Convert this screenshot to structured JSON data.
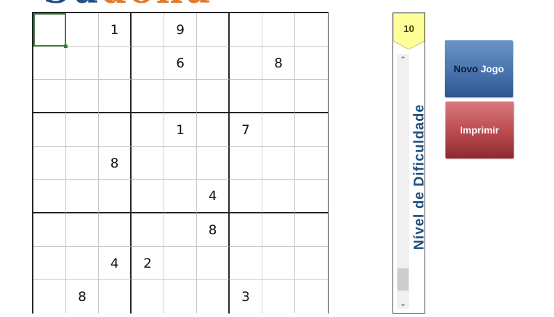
{
  "title": {
    "part_a": "Su",
    "part_b": "doku"
  },
  "grid": [
    [
      "",
      "",
      "1",
      "",
      "9",
      "",
      "",
      "",
      ""
    ],
    [
      "",
      "",
      "",
      "",
      "6",
      "",
      "",
      "8",
      ""
    ],
    [
      "",
      "",
      "",
      "",
      "",
      "",
      "",
      "",
      ""
    ],
    [
      "",
      "",
      "",
      "",
      "1",
      "",
      "7",
      "",
      ""
    ],
    [
      "",
      "",
      "8",
      "",
      "",
      "",
      "",
      "",
      ""
    ],
    [
      "",
      "",
      "",
      "",
      "",
      "4",
      "",
      "",
      ""
    ],
    [
      "",
      "",
      "",
      "",
      "",
      "8",
      "",
      "",
      ""
    ],
    [
      "",
      "",
      "4",
      "2",
      "",
      "",
      "",
      "",
      ""
    ],
    [
      "",
      "8",
      "",
      "",
      "",
      "",
      "3",
      "",
      ""
    ]
  ],
  "selected_cell": [
    0,
    0
  ],
  "difficulty": {
    "level": "10",
    "label": "Nível de Dificuldade",
    "badge_color": "#ffff99",
    "label_color": "#1f4f7e"
  },
  "icons": {
    "scroll_up": "chevron-up-icon",
    "scroll_down": "chevron-down-icon"
  },
  "buttons": {
    "new_game": {
      "word1": "Novo",
      "word2": "Jogo",
      "color": "#4a74ad"
    },
    "print": {
      "label": "Imprimir",
      "color": "#b94a4e"
    }
  }
}
